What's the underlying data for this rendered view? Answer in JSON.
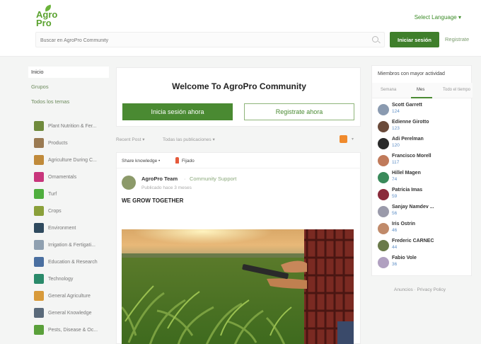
{
  "header": {
    "logo_line1": "Agro",
    "logo_line2": "Pro",
    "language": "Select Language ▾",
    "search_placeholder": "Buscar en AgroPro Community",
    "login_button": "Iniciar sesión",
    "register_link": "Registrate"
  },
  "sidebar": {
    "nav": [
      "Inicio",
      "Grupos",
      "Todos los temas"
    ],
    "categories": [
      {
        "label": "Plant Nutrition & Fer...",
        "color": "#6f8a3c"
      },
      {
        "label": "Products",
        "color": "#9a7a52"
      },
      {
        "label": "Agriculture During C...",
        "color": "#c08a3a"
      },
      {
        "label": "Ornamentals",
        "color": "#c8367c"
      },
      {
        "label": "Turf",
        "color": "#4fae3e"
      },
      {
        "label": "Crops",
        "color": "#8aa03a"
      },
      {
        "label": "Environment",
        "color": "#2f4a5e"
      },
      {
        "label": "Irrigation & Fertigati...",
        "color": "#8fa0b0"
      },
      {
        "label": "Education & Research",
        "color": "#4a6fa0"
      },
      {
        "label": "Technology",
        "color": "#2a8a6a"
      },
      {
        "label": "General Agriculture",
        "color": "#d89a3a"
      },
      {
        "label": "General Knowledge",
        "color": "#5a6a7a"
      },
      {
        "label": "Pests, Disease & Oc...",
        "color": "#5aa03a"
      }
    ]
  },
  "welcome": {
    "title": "Welcome To AgroPro Community",
    "login": "Inicia sesión ahora",
    "register": "Registrate ahora"
  },
  "filters": {
    "sort": "Recent Post ▾",
    "scope": "Todas las publicaciones ▾"
  },
  "post": {
    "share": "Share knowledge",
    "dot": "•",
    "pinned": "Fijado",
    "author": "AgroPro Team",
    "separator": "·",
    "community": "Community Support",
    "time": "Publicado hace 3 meses",
    "title": "WE GROW TOGETHER"
  },
  "right": {
    "title": "Miembros con mayor actividad",
    "tabs": [
      "Semana",
      "Mes",
      "Todo el tiempo"
    ],
    "members": [
      {
        "name": "Scott Garrett",
        "score": "124",
        "color": "#8a9ab0"
      },
      {
        "name": "Edienne Girotto",
        "score": "123",
        "color": "#6a4a3a"
      },
      {
        "name": "Adi Perelman",
        "score": "120",
        "color": "#2a2a2a"
      },
      {
        "name": "Francisco Morell",
        "score": "117",
        "color": "#c07a5a"
      },
      {
        "name": "Hillel Magen",
        "score": "74",
        "color": "#3a8a5a"
      },
      {
        "name": "Patricia Imas",
        "score": "59",
        "color": "#8a2a3a"
      },
      {
        "name": "Sanjay Namdev ...",
        "score": "56",
        "color": "#9a9aaa"
      },
      {
        "name": "Iris Ostrin",
        "score": "46",
        "color": "#c08a6a"
      },
      {
        "name": "Frederic CARNEC",
        "score": "44",
        "color": "#6a7a4a"
      },
      {
        "name": "Fabio Vole",
        "score": "36",
        "color": "#b0a0c0"
      }
    ],
    "footer": "Anuncios · Privacy Policy"
  }
}
